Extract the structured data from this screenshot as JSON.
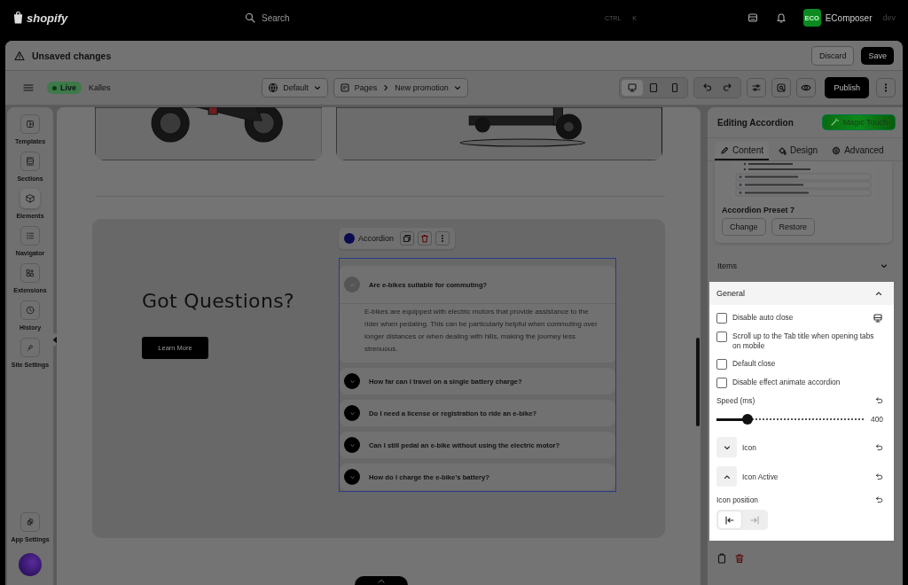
{
  "topbar": {
    "logo": "shopify",
    "search": {
      "placeholder": "Search",
      "shortcut": [
        "CTRL",
        "K"
      ]
    },
    "store_badge": "ECO",
    "store_name": "EComposer",
    "store_suffix": "dev"
  },
  "notice": {
    "title": "Unsaved changes",
    "buttons": [
      {
        "label": "Discard",
        "kind": "secondary"
      },
      {
        "label": "Save",
        "kind": "primary"
      }
    ]
  },
  "toolbar": {
    "status": "Live",
    "store": "Kalles",
    "language": "Default",
    "breadcrumb": [
      "Pages",
      "New promotion"
    ],
    "devices": [
      {
        "kind": "desktop",
        "selected": true
      },
      {
        "kind": "tablet",
        "selected": false
      },
      {
        "kind": "mobile",
        "selected": false
      }
    ],
    "publish": "Publish"
  },
  "sidebar": {
    "items": [
      {
        "kind": "templates",
        "label": "Templates",
        "selected": false
      },
      {
        "kind": "sections",
        "label": "Sections",
        "selected": false
      },
      {
        "kind": "elements",
        "label": "Elements",
        "selected": true
      },
      {
        "kind": "navigator",
        "label": "Navigator",
        "selected": false
      },
      {
        "kind": "extensions",
        "label": "Extensions",
        "selected": false
      },
      {
        "kind": "history",
        "label": "History",
        "selected": false
      },
      {
        "kind": "site",
        "label": "Site Settings",
        "selected": false
      }
    ],
    "app_settings": "App Settings"
  },
  "canvas": {
    "heading": "Got Questions?",
    "button": "Learn More",
    "element_toolbar": {
      "label": "Accordion"
    },
    "accordion": [
      {
        "question": "Are e-bikes suitable for commuting?",
        "expanded": true,
        "answer": "E-bikes are equipped with electric motors that provide assistance to the rider when pedaling. This can be particularly helpful when commuting over longer distances or when dealing with hills, making the journey less strenuous."
      },
      {
        "question": "How far can I travel on a single battery charge?",
        "expanded": false
      },
      {
        "question": "Do I need a license or registration to ride an e-bike?",
        "expanded": false
      },
      {
        "question": "Can I still pedal an e-bike without using the electric motor?",
        "expanded": false
      },
      {
        "question": "How do I charge the e-bike's battery?",
        "expanded": false
      }
    ]
  },
  "panel": {
    "title": "Editing Accordion",
    "magic_button": "Magic Touch",
    "tabs": [
      {
        "kind": "content",
        "label": "Content",
        "selected": true
      },
      {
        "kind": "design",
        "label": "Design",
        "selected": false
      },
      {
        "kind": "advanced",
        "label": "Advanced",
        "selected": false
      }
    ],
    "preset": {
      "name": "Accordion Preset 7",
      "buttons": [
        "Change",
        "Restore"
      ]
    },
    "sections": [
      {
        "title": "Items",
        "expanded": false
      },
      {
        "title": "General",
        "expanded": true
      }
    ],
    "options": [
      {
        "label": "Disable auto close",
        "checked": false,
        "device_icon": true
      },
      {
        "label": "Scroll up to the Tab title when opening tabs on mobile",
        "checked": false,
        "device_icon": false
      },
      {
        "label": "Default close",
        "checked": false,
        "device_icon": false
      },
      {
        "label": "Disable effect animate accordion",
        "checked": false,
        "device_icon": false
      }
    ],
    "speed": {
      "label": "Speed (ms)",
      "level": 0.21,
      "reading": "400"
    },
    "icons": [
      {
        "label": "Icon",
        "kind": "down"
      },
      {
        "label": "Icon Active",
        "kind": "up"
      }
    ],
    "icon_position": {
      "label": "Icon position",
      "options": [
        {
          "kind": "left",
          "selected": true
        },
        {
          "kind": "right",
          "selected": false
        }
      ]
    }
  }
}
